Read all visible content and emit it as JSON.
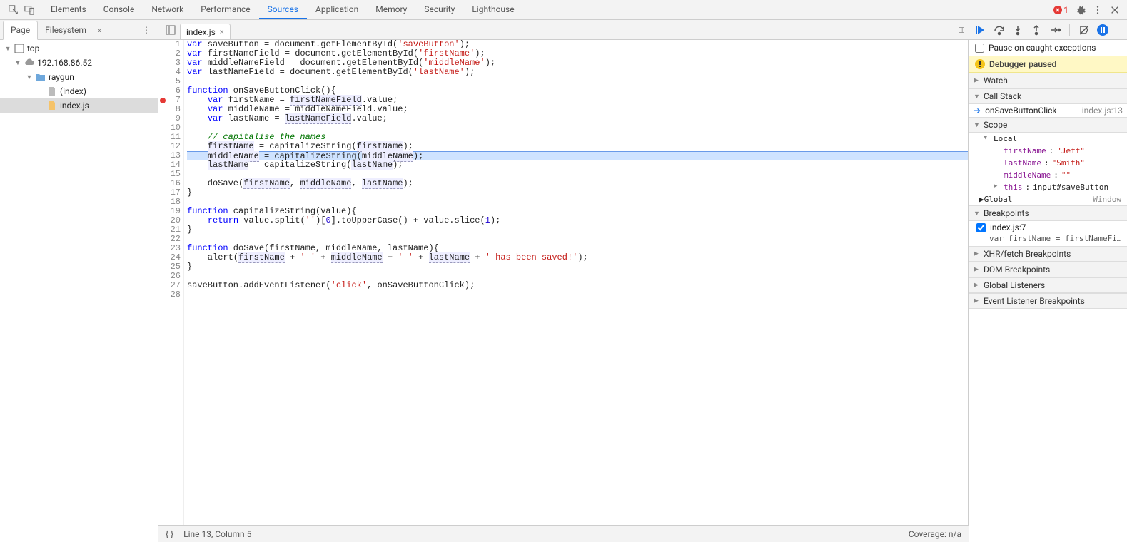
{
  "topTabs": {
    "items": [
      "Elements",
      "Console",
      "Network",
      "Performance",
      "Sources",
      "Application",
      "Memory",
      "Security",
      "Lighthouse"
    ],
    "active": 4,
    "errorCount": "1"
  },
  "navigator": {
    "tabs": {
      "page": "Page",
      "filesystem": "Filesystem"
    },
    "tree": {
      "top": "top",
      "host": "192.168.86.52",
      "folder": "raygun",
      "files": [
        "(index)",
        "index.js"
      ],
      "selectedFile": 1
    }
  },
  "editor": {
    "tabName": "index.js",
    "lines": [
      {
        "n": 1,
        "html": "<span class='tok-kw'>var</span> saveButton = document.getElementById(<span class='tok-str'>'saveButton'</span>);"
      },
      {
        "n": 2,
        "html": "<span class='tok-kw'>var</span> firstNameField = document.getElementById(<span class='tok-str'>'firstName'</span>);"
      },
      {
        "n": 3,
        "html": "<span class='tok-kw'>var</span> middleNameField = document.getElementById(<span class='tok-str'>'middleName'</span>);"
      },
      {
        "n": 4,
        "html": "<span class='tok-kw'>var</span> lastNameField = document.getElementById(<span class='tok-str'>'lastName'</span>);"
      },
      {
        "n": 5,
        "html": ""
      },
      {
        "n": 6,
        "html": "<span class='tok-kw'>function</span> onSaveButtonClick(){"
      },
      {
        "n": 7,
        "bp": true,
        "html": "    <span class='tok-kw'>var</span> firstName = <span class='tok-id2'>firstNameField</span>.value;"
      },
      {
        "n": 8,
        "html": "    <span class='tok-kw'>var</span> middleName = middleNameField.value;"
      },
      {
        "n": 9,
        "html": "    <span class='tok-kw'>var</span> lastName = <span class='tok-id2'>lastNameField</span>.value;"
      },
      {
        "n": 10,
        "html": ""
      },
      {
        "n": 11,
        "html": "    <span class='tok-cm'>// capitalise the names</span>"
      },
      {
        "n": 12,
        "html": "    <span class='tok-id2'>firstName</span> = capitalizeString(<span class='tok-id2'>firstName</span>);"
      },
      {
        "n": 13,
        "exec": true,
        "html": "    <span class='tok-id2'>middleName</span> = capitalizeString(<span class='tok-id2'>middleName</span>);"
      },
      {
        "n": 14,
        "html": "    <span class='tok-id2'>lastName</span> = capitalizeString(<span class='tok-id2'>lastName</span>);"
      },
      {
        "n": 15,
        "html": ""
      },
      {
        "n": 16,
        "html": "    doSave(<span class='tok-id2'>firstName</span>, <span class='tok-id2'>middleName</span>, <span class='tok-id2'>lastName</span>);"
      },
      {
        "n": 17,
        "html": "}"
      },
      {
        "n": 18,
        "html": ""
      },
      {
        "n": 19,
        "html": "<span class='tok-kw'>function</span> capitalizeString(value){"
      },
      {
        "n": 20,
        "html": "    <span class='tok-kw'>return</span> value.split(<span class='tok-str'>''</span>)[<span class='tok-num'>0</span>].toUpperCase() + value.slice(<span class='tok-num'>1</span>);"
      },
      {
        "n": 21,
        "html": "}"
      },
      {
        "n": 22,
        "html": ""
      },
      {
        "n": 23,
        "html": "<span class='tok-kw'>function</span> doSave(firstName, middleName, lastName){"
      },
      {
        "n": 24,
        "html": "    alert(<span class='tok-id2'>firstName</span> + <span class='tok-str'>' '</span> + <span class='tok-id2'>middleName</span> + <span class='tok-str'>' '</span> + <span class='tok-id2'>lastName</span> + <span class='tok-str'>' has been saved!'</span>);"
      },
      {
        "n": 25,
        "html": "}"
      },
      {
        "n": 26,
        "html": ""
      },
      {
        "n": 27,
        "html": "saveButton.addEventListener(<span class='tok-str'>'click'</span>, onSaveButtonClick);"
      },
      {
        "n": 28,
        "html": ""
      }
    ],
    "status": {
      "cursor": "Line 13, Column 5",
      "coverage": "Coverage: n/a"
    }
  },
  "debugger": {
    "pauseCaughtLabel": "Pause on caught exceptions",
    "pausedLabel": "Debugger paused",
    "sections": {
      "watch": "Watch",
      "callstack": "Call Stack",
      "scope": "Scope",
      "breakpoints": "Breakpoints",
      "xhr": "XHR/fetch Breakpoints",
      "dom": "DOM Breakpoints",
      "globalListeners": "Global Listeners",
      "eventListener": "Event Listener Breakpoints"
    },
    "callstack": {
      "frame": "onSaveButtonClick",
      "location": "index.js:13"
    },
    "scope": {
      "localLabel": "Local",
      "vars": [
        {
          "name": "firstName",
          "value": "\"Jeff\""
        },
        {
          "name": "lastName",
          "value": "\"Smith\""
        },
        {
          "name": "middleName",
          "value": "\"\""
        }
      ],
      "thisLabel": "this",
      "thisValue": "input#saveButton",
      "globalLabel": "Global",
      "globalValue": "Window"
    },
    "breakpoints": {
      "label": "index.js:7",
      "code": "var firstName = firstNameFi…"
    }
  }
}
